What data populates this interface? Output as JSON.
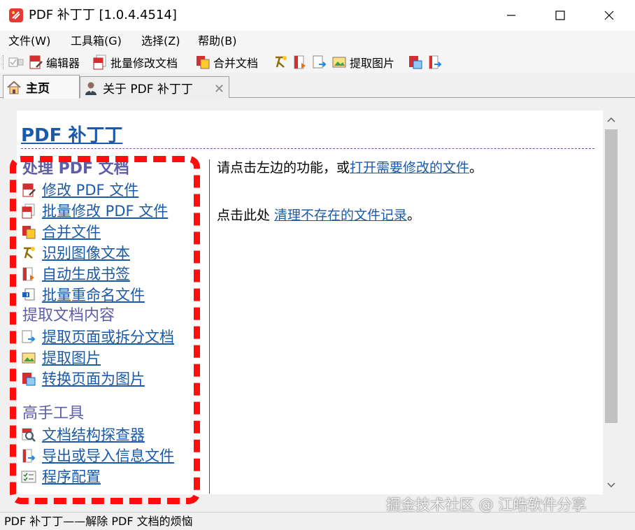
{
  "window": {
    "title": "PDF 补丁丁 [1.0.4.4514]",
    "icon": "pdf-patcher-logo"
  },
  "menubar": {
    "items": [
      {
        "label": "文件(W)"
      },
      {
        "label": "工具箱(G)"
      },
      {
        "label": "选择(Z)"
      },
      {
        "label": "帮助(B)"
      }
    ]
  },
  "toolbar": {
    "editor": "编辑器",
    "batch_modify": "批量修改文档",
    "merge": "合并文档",
    "extract_images": "提取图片"
  },
  "tabs": [
    {
      "label": "主页",
      "icon": "home-icon",
      "active": true
    },
    {
      "label": "关于 PDF 补丁丁",
      "icon": "user-icon",
      "closable": true
    }
  ],
  "main": {
    "page_title": "PDF 补丁丁",
    "sections": [
      {
        "heading": "处理 PDF 文档",
        "links": [
          {
            "label": "修改 PDF 文件",
            "icon": "pdf-edit-icon"
          },
          {
            "label": "批量修改 PDF 文件",
            "icon": "pdf-batch-icon"
          },
          {
            "label": "合并文件",
            "icon": "merge-icon"
          },
          {
            "label": "识别图像文本",
            "icon": "ocr-icon"
          },
          {
            "label": "自动生成书签",
            "icon": "bookmark-icon"
          },
          {
            "label": "批量重命名文件",
            "icon": "rename-icon"
          }
        ]
      },
      {
        "heading": "提取文档内容",
        "links": [
          {
            "label": "提取页面或拆分文档",
            "icon": "extract-pages-icon"
          },
          {
            "label": "提取图片",
            "icon": "extract-images-icon"
          },
          {
            "label": "转换页面为图片",
            "icon": "render-pages-icon"
          }
        ]
      },
      {
        "heading": "高手工具",
        "links": [
          {
            "label": "文档结构探查器",
            "icon": "inspector-icon"
          },
          {
            "label": "导出或导入信息文件",
            "icon": "info-file-icon"
          },
          {
            "label": "程序配置",
            "icon": "settings-icon"
          }
        ]
      }
    ],
    "right": {
      "line1_prefix": "请点击左边的功能，或",
      "line1_link": "打开需要修改的文件",
      "line1_suffix": "。",
      "line2_prefix": "点击此处 ",
      "line2_link": "清理不存在的文件记录",
      "line2_suffix": "。"
    }
  },
  "statusbar": {
    "text": "PDF 补丁丁——解除 PDF 文档的烦恼"
  },
  "watermark": "掘金技术社区 @ 江皓软件分享",
  "colors": {
    "link": "#1a5aa8",
    "section_heading": "#5e5ea8",
    "highlight": "#ff0d0d"
  }
}
